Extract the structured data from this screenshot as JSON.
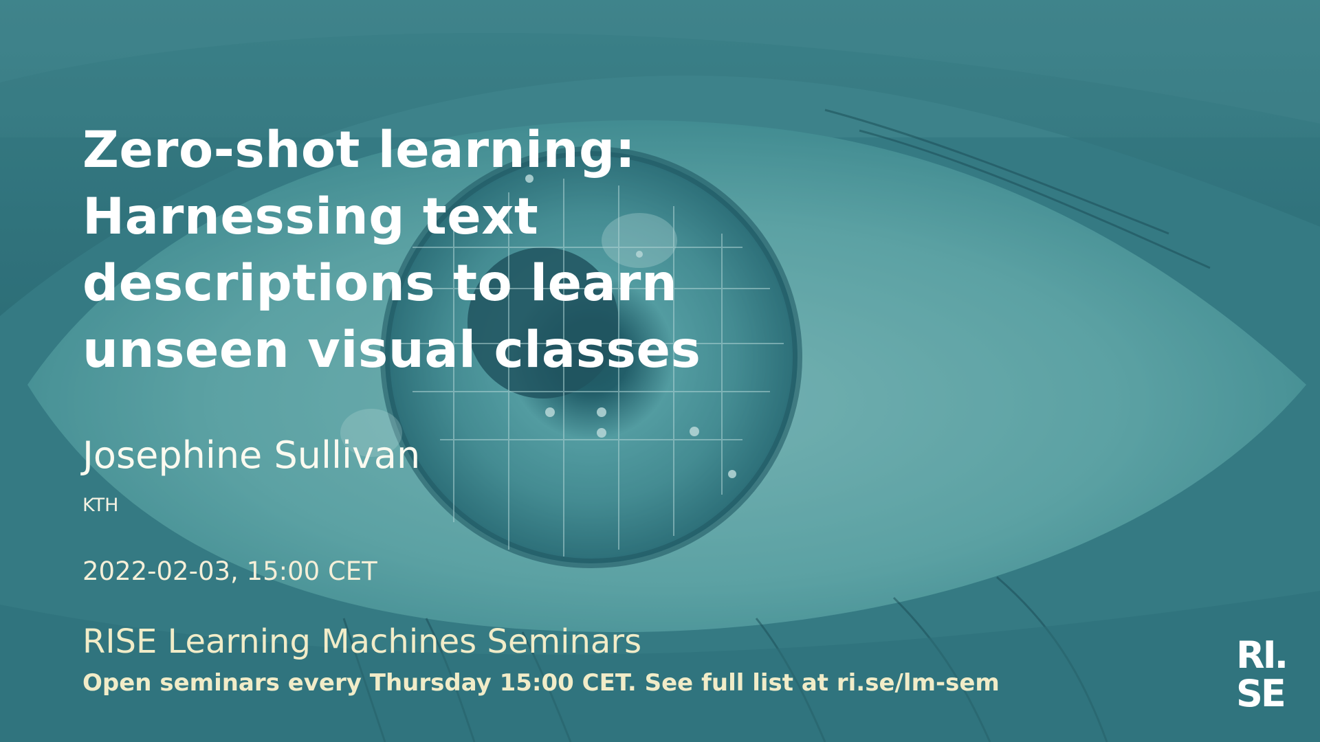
{
  "title_lines": [
    "Zero-shot learning:",
    "Harnessing text",
    "descriptions to learn",
    "unseen visual classes"
  ],
  "speaker": "Josephine Sullivan",
  "affiliation": "KTH",
  "datetime": "2022-02-03, 15:00 CET",
  "series": "RISE Learning Machines Seminars",
  "subline": "Open seminars every Thursday 15:00 CET. See full list at ri.se/lm-sem",
  "logo": {
    "line1": "RI.",
    "line2": "SE"
  },
  "colors": {
    "background": "#3a8088",
    "title": "#ffffff",
    "accent_text": "#f1ecc8"
  }
}
